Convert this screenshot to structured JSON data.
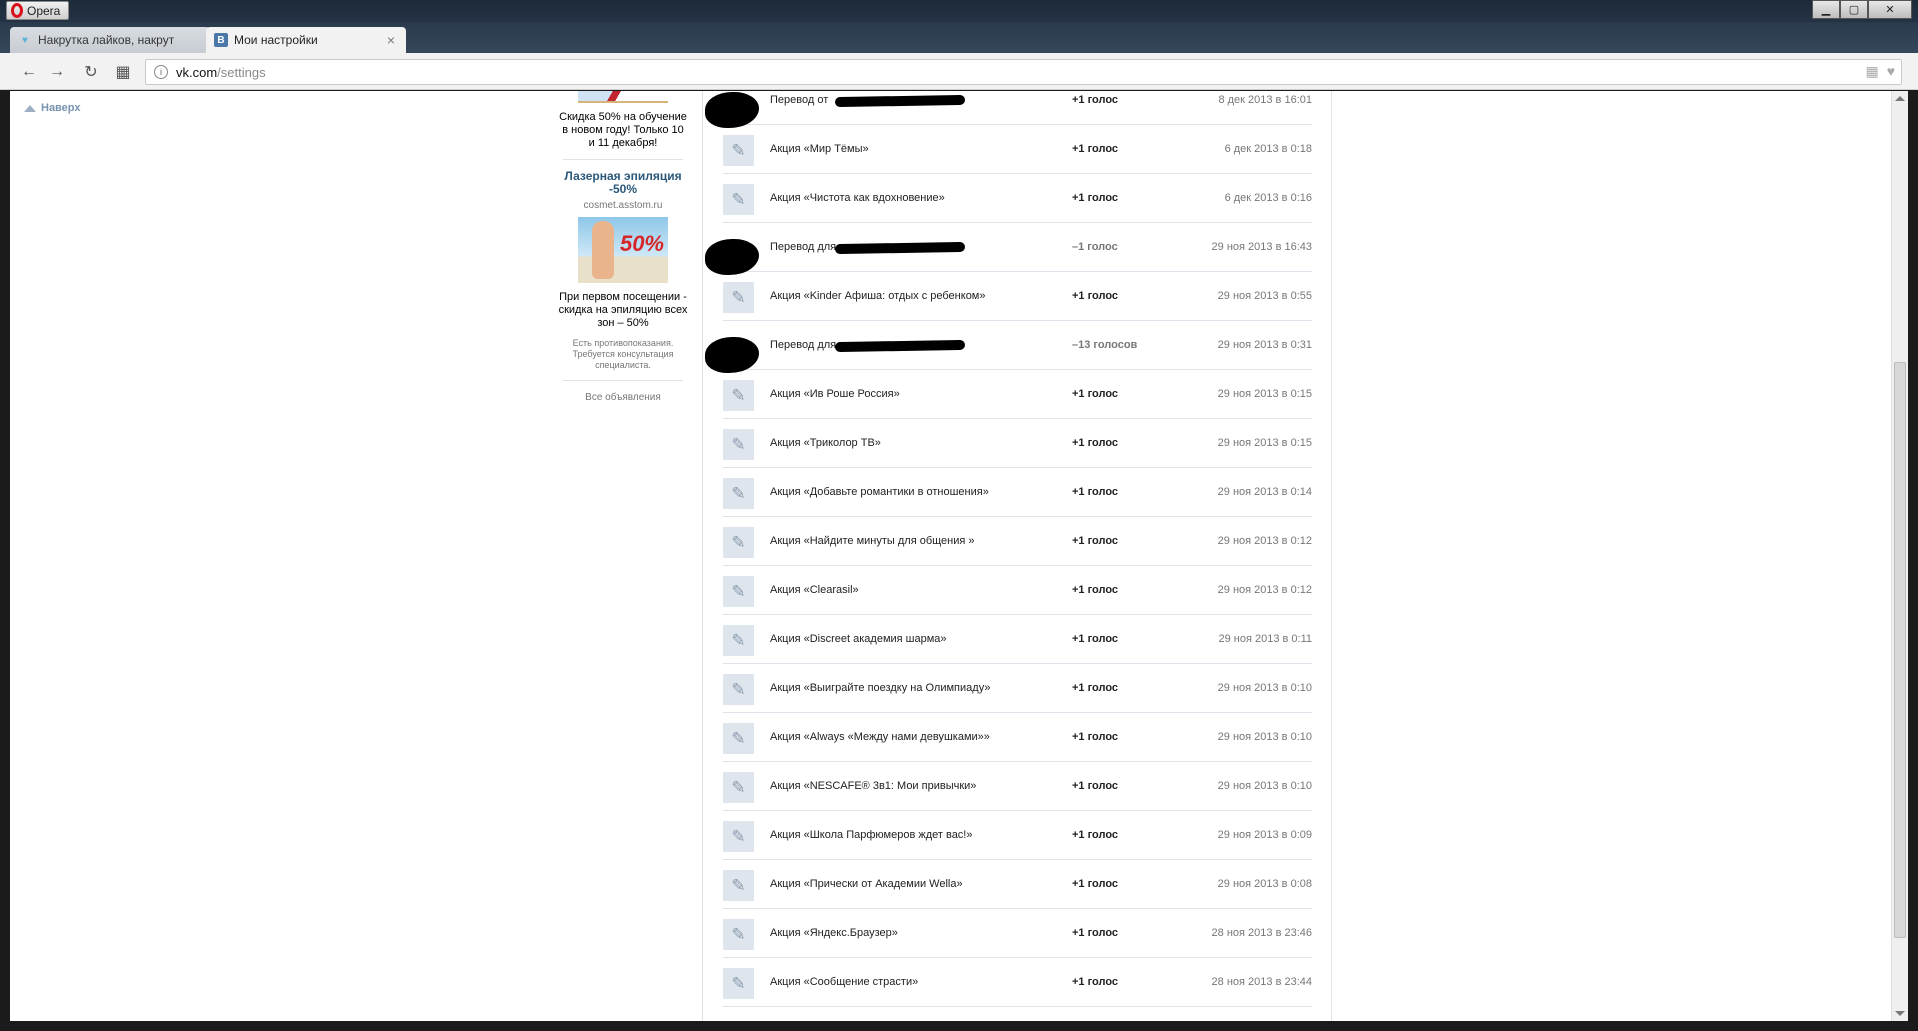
{
  "browser": {
    "app_name": "Opera",
    "tabs": [
      {
        "label": "Накрутка лайков, накрут",
        "icon": "heart-icon",
        "active": false
      },
      {
        "label": "Мои настройки",
        "icon": "vk-icon",
        "active": true
      }
    ],
    "new_tab": "+",
    "url_host": "vk.com",
    "url_path": "/settings"
  },
  "page": {
    "back_to_top": "Наверх"
  },
  "ads": {
    "ad1_text": "Скидка 50% на обучение в новом году! Только 10 и 11 декабря!",
    "ad2_title": "Лазерная эпиляция -50%",
    "ad2_domain": "cosmet.asstom.ru",
    "ad2_badge": "50%",
    "ad2_text": "При первом посещении - скидка на эпиляцию всех зон – 50%",
    "ad2_note": "Есть противопоказания. Требуется консультация специалиста.",
    "all_ads": "Все объявления"
  },
  "history": [
    {
      "desc": "Перевод от",
      "votes": "+1 голос",
      "date": "8 дек 2013 в 16:01",
      "redacted": true,
      "negative": false
    },
    {
      "desc": "Акция «Мир Тёмы»",
      "votes": "+1 голос",
      "date": "6 дек 2013 в 0:18",
      "redacted": false,
      "negative": false
    },
    {
      "desc": "Акция «Чистота как вдохновение»",
      "votes": "+1 голос",
      "date": "6 дек 2013 в 0:16",
      "redacted": false,
      "negative": false
    },
    {
      "desc": "Перевод для",
      "votes": "–1 голос",
      "date": "29 ноя 2013 в 16:43",
      "redacted": true,
      "negative": true
    },
    {
      "desc": "Акция «Kinder Афиша: отдых с ребенком»",
      "votes": "+1 голос",
      "date": "29 ноя 2013 в 0:55",
      "redacted": false,
      "negative": false
    },
    {
      "desc": "Перевод для",
      "votes": "–13 голосов",
      "date": "29 ноя 2013 в 0:31",
      "redacted": true,
      "negative": true
    },
    {
      "desc": "Акция «Ив Роше Россия»",
      "votes": "+1 голос",
      "date": "29 ноя 2013 в 0:15",
      "redacted": false,
      "negative": false
    },
    {
      "desc": "Акция «Триколор ТВ»",
      "votes": "+1 голос",
      "date": "29 ноя 2013 в 0:15",
      "redacted": false,
      "negative": false
    },
    {
      "desc": "Акция «Добавьте романтики в отношения»",
      "votes": "+1 голос",
      "date": "29 ноя 2013 в 0:14",
      "redacted": false,
      "negative": false
    },
    {
      "desc": "Акция «Найдите минуты для общения »",
      "votes": "+1 голос",
      "date": "29 ноя 2013 в 0:12",
      "redacted": false,
      "negative": false
    },
    {
      "desc": "Акция «Clearasil»",
      "votes": "+1 голос",
      "date": "29 ноя 2013 в 0:12",
      "redacted": false,
      "negative": false
    },
    {
      "desc": "Акция «Discreet академия шарма»",
      "votes": "+1 голос",
      "date": "29 ноя 2013 в 0:11",
      "redacted": false,
      "negative": false
    },
    {
      "desc": "Акция «Выиграйте поездку на Олимпиаду»",
      "votes": "+1 голос",
      "date": "29 ноя 2013 в 0:10",
      "redacted": false,
      "negative": false
    },
    {
      "desc": "Акция «Always «Между нами девушками»»",
      "votes": "+1 голос",
      "date": "29 ноя 2013 в 0:10",
      "redacted": false,
      "negative": false
    },
    {
      "desc": "Акция «NESCAFE® 3в1: Мои привычки»",
      "votes": "+1 голос",
      "date": "29 ноя 2013 в 0:10",
      "redacted": false,
      "negative": false
    },
    {
      "desc": "Акция «Школа Парфюмеров ждет вас!»",
      "votes": "+1 голос",
      "date": "29 ноя 2013 в 0:09",
      "redacted": false,
      "negative": false
    },
    {
      "desc": "Акция «Прически от Академии Wella»",
      "votes": "+1 голос",
      "date": "29 ноя 2013 в 0:08",
      "redacted": false,
      "negative": false
    },
    {
      "desc": "Акция «Яндекс.Браузер»",
      "votes": "+1 голос",
      "date": "28 ноя 2013 в 23:46",
      "redacted": false,
      "negative": false
    },
    {
      "desc": "Акция «Сообщение страсти»",
      "votes": "+1 голос",
      "date": "28 ноя 2013 в 23:44",
      "redacted": false,
      "negative": false
    }
  ]
}
